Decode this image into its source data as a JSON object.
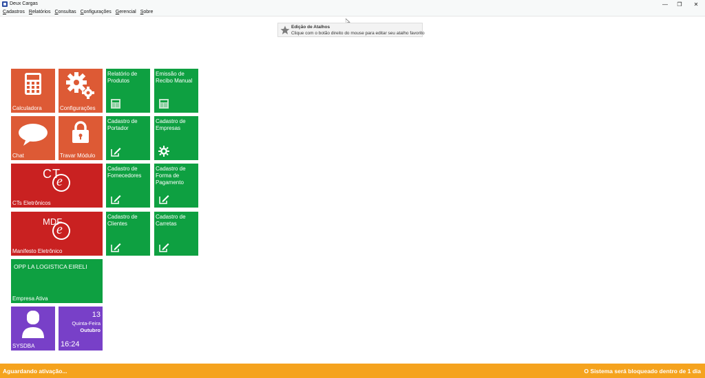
{
  "window": {
    "title": "Deux Cargas",
    "minimize": "—",
    "maximize": "❐",
    "close": "✕"
  },
  "menu": [
    {
      "first": "C",
      "rest": "adastros"
    },
    {
      "first": "R",
      "rest": "elatórios"
    },
    {
      "first": "C",
      "rest": "onsultas"
    },
    {
      "first": "C",
      "rest": "onfigurações"
    },
    {
      "first": "G",
      "rest": "erencial"
    },
    {
      "first": "S",
      "rest": "obre"
    }
  ],
  "tooltip": {
    "title": "Edição de Atalhos",
    "text": "Clique com o botão direito do mouse para editar seu atalho favorito"
  },
  "tiles": {
    "calculadora": "Calculadora",
    "configuracoes": "Configurações",
    "chat": "Chat",
    "travar": "Travar Módulo",
    "cte": "CTs Eletrônicos",
    "cte_logo": "CT",
    "mdfe": "Manifesto Eletrônico",
    "mdfe_logo": "MDF",
    "logo_e": "e",
    "relatorio_produtos": [
      "Relatório de",
      "Produtos"
    ],
    "recibo_manual": [
      "Emissão de",
      "Recibo Manual"
    ],
    "cadastro_portador": [
      "Cadastro de",
      "Portador"
    ],
    "cadastro_empresas": [
      "Cadastro de",
      "Empresas"
    ],
    "cadastro_fornecedores": [
      "Cadastro de",
      "Fornecedores"
    ],
    "cadastro_forma_pagamento": [
      "Cadastro de",
      "Forma de",
      "Pagamento"
    ],
    "cadastro_clientes": [
      "Cadastro de",
      "Clientes"
    ],
    "cadastro_carretas": [
      "Cadastro de",
      "Carretas"
    ],
    "empresa_nome": "OPP LA LOGISTICA EIRELI",
    "empresa_label": "Empresa Ativa",
    "user": "SYSDBA",
    "date_day": "13",
    "date_weekday": "Quinta-Feira",
    "date_month": "Outubro",
    "time": "16:24"
  },
  "colors": {
    "orange": "#dd5a35",
    "red": "#c92121",
    "green": "#0ea041",
    "purple": "#7840c8",
    "status": "#f5a31e"
  },
  "status": {
    "left": "Aguardando ativação...",
    "right": "O Sistema será bloqueado dentro de 1 dia"
  }
}
